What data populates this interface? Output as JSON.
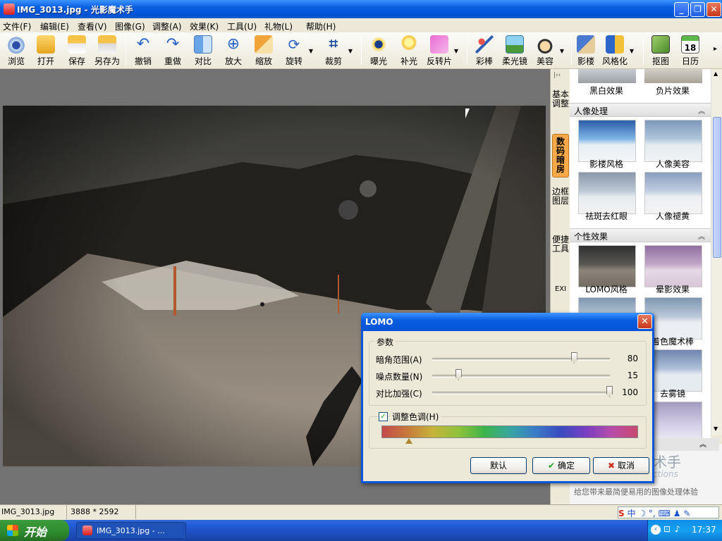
{
  "window": {
    "title": "IMG_3013.jpg - 光影魔术手"
  },
  "menu": [
    "文件(F)",
    "编辑(E)",
    "查看(V)",
    "图像(G)",
    "调整(A)",
    "效果(K)",
    "工具(U)",
    "礼物(L)",
    "帮助(H)"
  ],
  "toolbar": [
    "浏览",
    "打开",
    "保存",
    "另存为",
    "撤销",
    "重做",
    "对比",
    "放大",
    "缩放",
    "旋转",
    "裁剪",
    "曝光",
    "补光",
    "反转片",
    "彩棒",
    "柔光镜",
    "美容",
    "影楼",
    "风格化",
    "抠图",
    "日历"
  ],
  "calendar_day": "18",
  "side_tabs": [
    "基本调整",
    "数码暗房",
    "边框图层",
    "便捷工具",
    "EXI"
  ],
  "panel": {
    "top_labels": [
      "黑白效果",
      "负片效果"
    ],
    "section1": "人像处理",
    "s1_items": [
      "影楼风格",
      "人像美容",
      "祛斑去红眼",
      "人像褪黄"
    ],
    "section2": "个性效果",
    "s2_items": [
      "LOMO风格",
      "晕影效果",
      "着色魔术棒",
      "去雾镜"
    ],
    "brand_text": "术手",
    "brand_sub": "ctions",
    "slogan": "给您带来最简便易用的图像处理体验"
  },
  "status": {
    "filename": "IMG_3013.jpg",
    "dimensions": "3888 * 2592"
  },
  "dialog": {
    "title": "LOMO",
    "group_label": "参数",
    "sliders": [
      {
        "label": "暗角范围(A)",
        "value": 80
      },
      {
        "label": "噪点数量(N)",
        "value": 15
      },
      {
        "label": "对比加强(C)",
        "value": 100
      }
    ],
    "hue_label": "调整色调(H)",
    "hue_checked": true,
    "default": "默认",
    "ok": "确定",
    "cancel": "取消"
  },
  "taskbar": {
    "start": "开始",
    "task": "IMG_3013.jpg - ...",
    "time": "17:37"
  },
  "colors": {
    "title_blue": "#0a5ee0",
    "dialog_border": "#0a56d8",
    "active_tab": "#f7a94a"
  }
}
